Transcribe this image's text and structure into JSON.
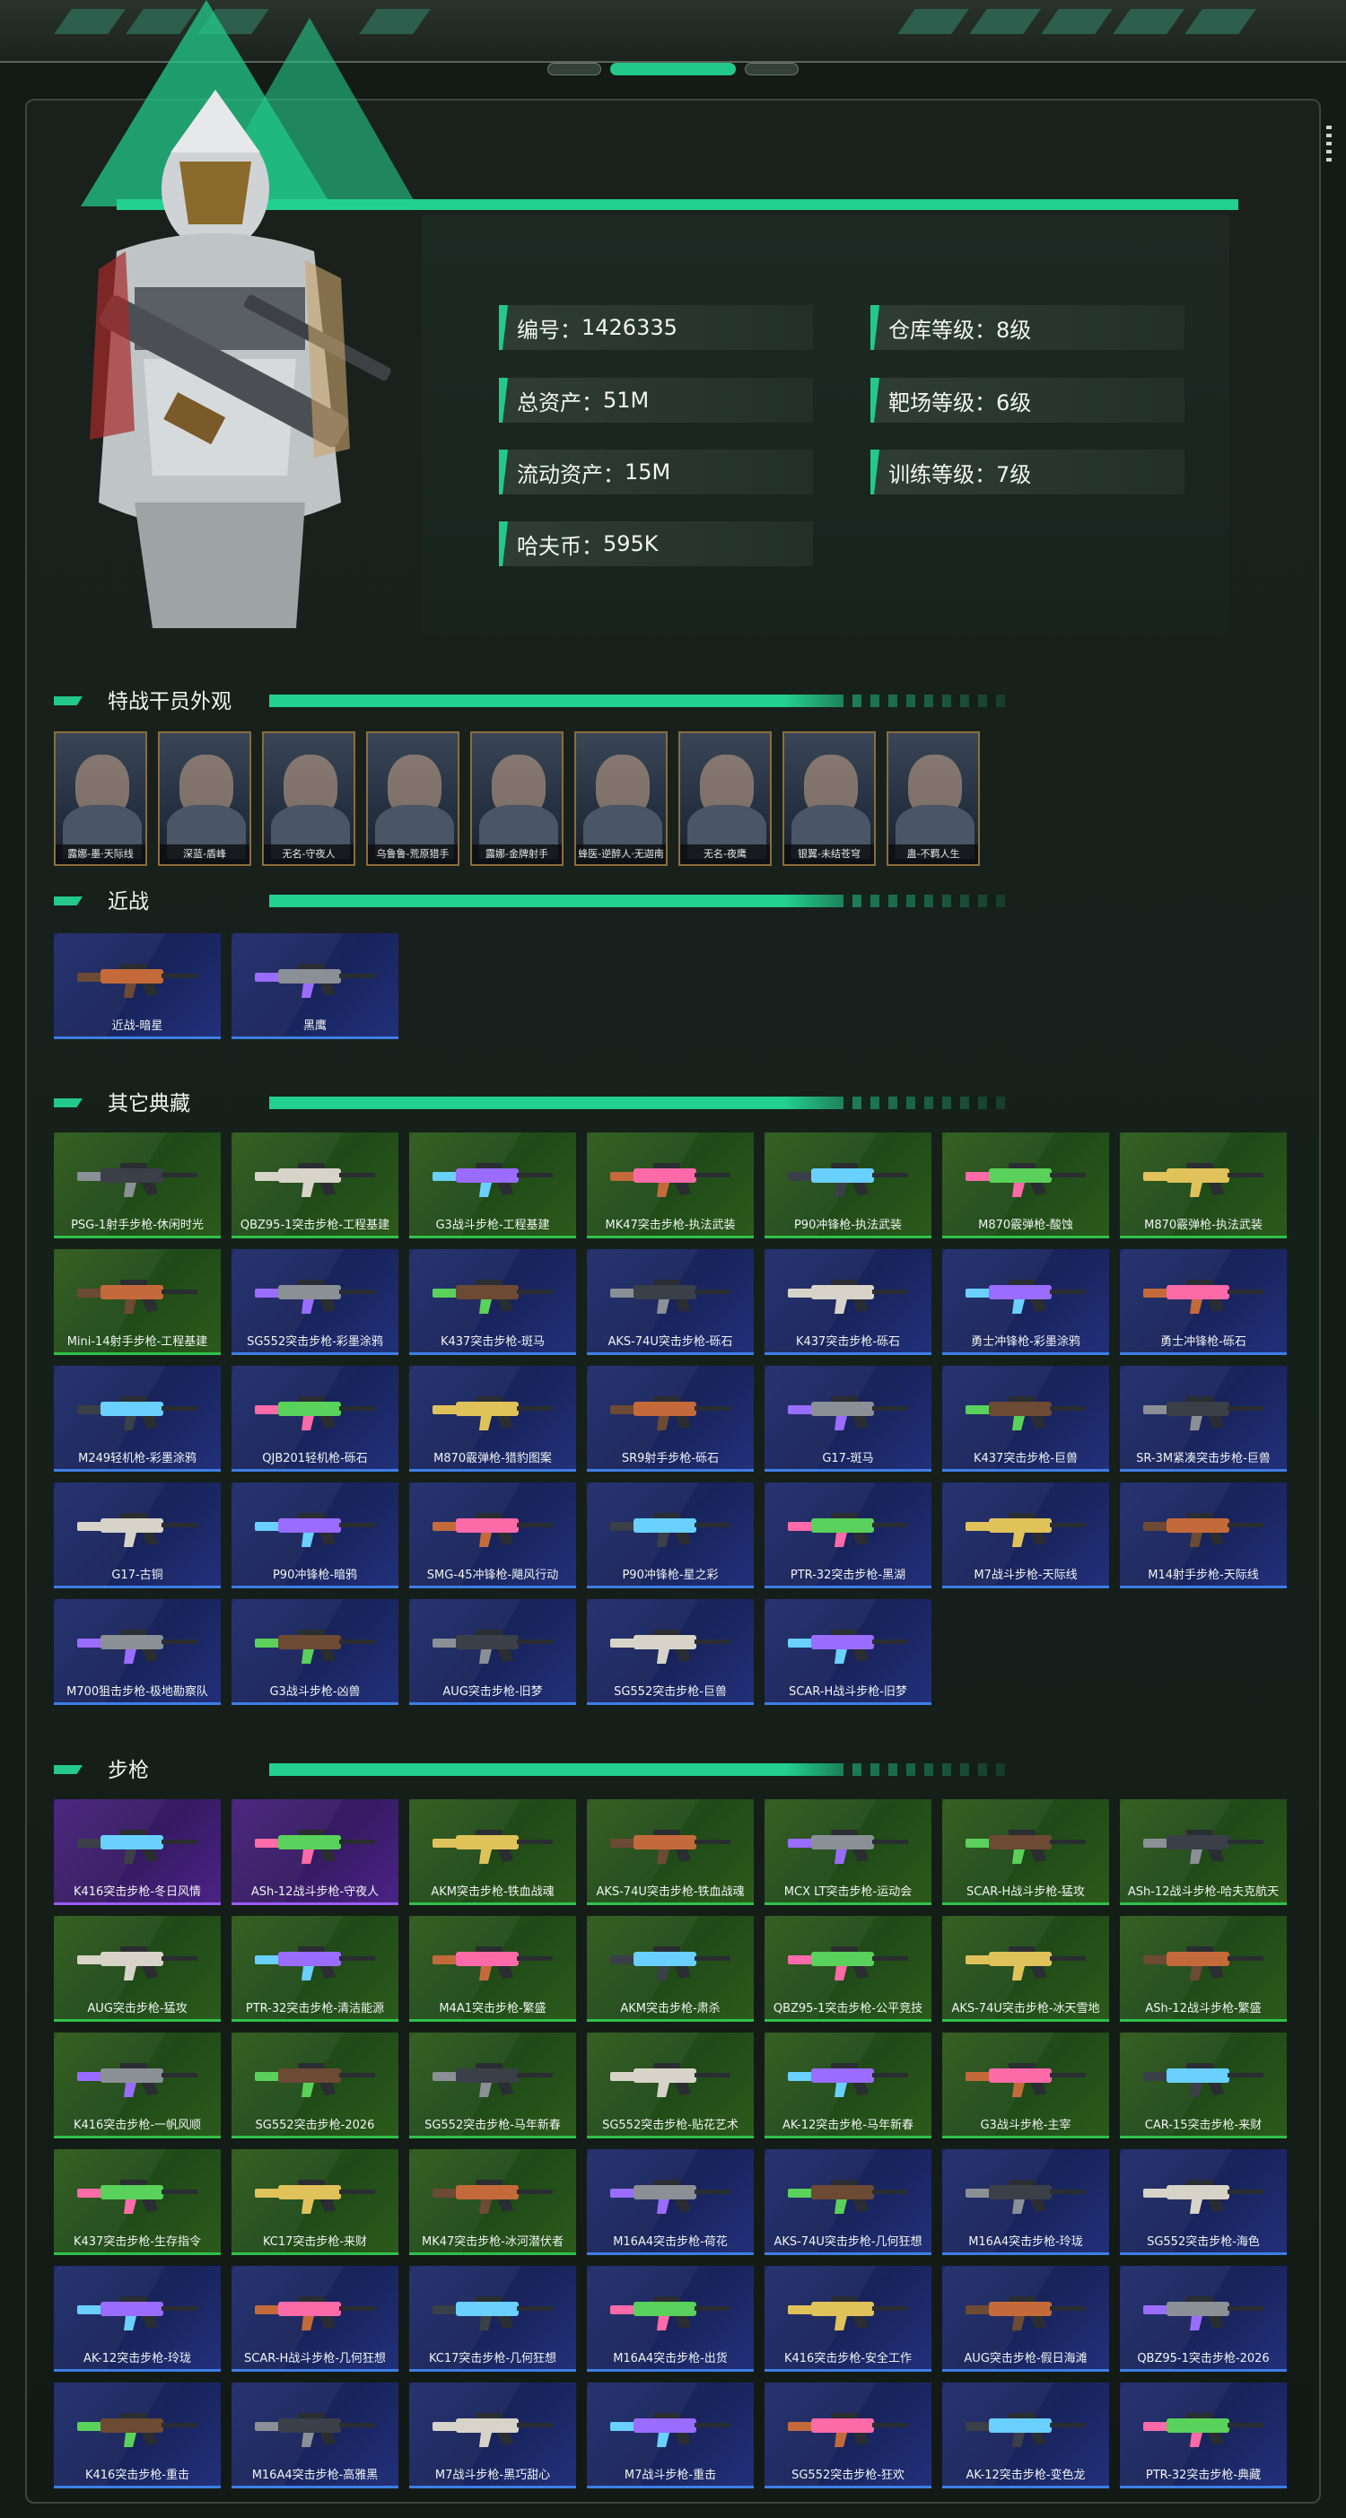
{
  "profile": {
    "stats": [
      {
        "label": "编号",
        "value": "1426335"
      },
      {
        "label": "仓库等级",
        "value": "8级"
      },
      {
        "label": "总资产",
        "value": "51M"
      },
      {
        "label": "靶场等级",
        "value": "6级"
      },
      {
        "label": "流动资产",
        "value": "15M"
      },
      {
        "label": "训练等级",
        "value": "7级"
      },
      {
        "label": "哈夫币",
        "value": "595K"
      }
    ],
    "colon": "："
  },
  "sections": {
    "operators": "特战干员外观",
    "melee": "近战",
    "collection": "其它典藏",
    "rifles": "步枪"
  },
  "operators": [
    "露娜-墨·天际线",
    "深蓝-盾峰",
    "无名-守夜人",
    "乌鲁鲁-荒原猎手",
    "露娜-金牌射手",
    "蜂医-逆醉人·无迦南",
    "无名-夜鹰",
    "银翼-未结苍穹",
    "蛊-不羁人生"
  ],
  "melee": [
    {
      "name": "近战-暗星",
      "color": "blue"
    },
    {
      "name": "黑鹰",
      "color": "blue"
    }
  ],
  "collection": [
    {
      "name": "PSG-1射手步枪-休闲时光",
      "color": "green"
    },
    {
      "name": "QBZ95-1突击步枪-工程基建",
      "color": "green"
    },
    {
      "name": "G3战斗步枪-工程基建",
      "color": "green"
    },
    {
      "name": "MK47突击步枪-执法武装",
      "color": "green"
    },
    {
      "name": "P90冲锋枪-执法武装",
      "color": "green"
    },
    {
      "name": "M870霰弹枪-酸蚀",
      "color": "green"
    },
    {
      "name": "M870霰弹枪-执法武装",
      "color": "green"
    },
    {
      "name": "Mini-14射手步枪-工程基建",
      "color": "green"
    },
    {
      "name": "SG552突击步枪-彩墨涂鸦",
      "color": "blue"
    },
    {
      "name": "K437突击步枪-斑马",
      "color": "blue"
    },
    {
      "name": "AKS-74U突击步枪-砾石",
      "color": "blue"
    },
    {
      "name": "K437突击步枪-砾石",
      "color": "blue"
    },
    {
      "name": "勇士冲锋枪-彩墨涂鸦",
      "color": "blue"
    },
    {
      "name": "勇士冲锋枪-砾石",
      "color": "blue"
    },
    {
      "name": "M249轻机枪-彩墨涂鸦",
      "color": "blue"
    },
    {
      "name": "QJB201轻机枪-砾石",
      "color": "blue"
    },
    {
      "name": "M870霰弹枪-猎豹图案",
      "color": "blue"
    },
    {
      "name": "SR9射手步枪-砾石",
      "color": "blue"
    },
    {
      "name": "G17-斑马",
      "color": "blue"
    },
    {
      "name": "K437突击步枪-巨兽",
      "color": "blue"
    },
    {
      "name": "SR-3M紧凑突击步枪-巨兽",
      "color": "blue"
    },
    {
      "name": "G17-古铜",
      "color": "blue"
    },
    {
      "name": "P90冲锋枪-暗鸦",
      "color": "blue"
    },
    {
      "name": "SMG-45冲锋枪-飓风行动",
      "color": "blue"
    },
    {
      "name": "P90冲锋枪-星之彩",
      "color": "blue"
    },
    {
      "name": "PTR-32突击步枪-黑湖",
      "color": "blue"
    },
    {
      "name": "M7战斗步枪-天际线",
      "color": "blue"
    },
    {
      "name": "M14射手步枪-天际线",
      "color": "blue"
    },
    {
      "name": "M700狙击步枪-极地勘察队",
      "color": "blue"
    },
    {
      "name": "G3战斗步枪-凶兽",
      "color": "blue"
    },
    {
      "name": "AUG突击步枪-旧梦",
      "color": "blue"
    },
    {
      "name": "SG552突击步枪-巨兽",
      "color": "blue"
    },
    {
      "name": "SCAR-H战斗步枪-旧梦",
      "color": "blue"
    }
  ],
  "rifles": [
    {
      "name": "K416突击步枪-冬日风情",
      "color": "purple"
    },
    {
      "name": "ASh-12战斗步枪-守夜人",
      "color": "purple"
    },
    {
      "name": "AKM突击步枪-铁血战魂",
      "color": "green"
    },
    {
      "name": "AKS-74U突击步枪-铁血战魂",
      "color": "green"
    },
    {
      "name": "MCX LT突击步枪-运动会",
      "color": "green"
    },
    {
      "name": "SCAR-H战斗步枪-猛攻",
      "color": "green"
    },
    {
      "name": "ASh-12战斗步枪-哈夫克航天",
      "color": "green"
    },
    {
      "name": "AUG突击步枪-猛攻",
      "color": "green"
    },
    {
      "name": "PTR-32突击步枪-清洁能源",
      "color": "green"
    },
    {
      "name": "M4A1突击步枪-繁盛",
      "color": "green"
    },
    {
      "name": "AKM突击步枪-肃杀",
      "color": "green"
    },
    {
      "name": "QBZ95-1突击步枪-公平竞技",
      "color": "green"
    },
    {
      "name": "AKS-74U突击步枪-冰天雪地",
      "color": "green"
    },
    {
      "name": "ASh-12战斗步枪-繁盛",
      "color": "green"
    },
    {
      "name": "K416突击步枪-一帆风顺",
      "color": "green"
    },
    {
      "name": "SG552突击步枪-2026",
      "color": "green"
    },
    {
      "name": "SG552突击步枪-马年新春",
      "color": "green"
    },
    {
      "name": "SG552突击步枪-贴花艺术",
      "color": "green"
    },
    {
      "name": "AK-12突击步枪-马年新春",
      "color": "green"
    },
    {
      "name": "G3战斗步枪-主宰",
      "color": "green"
    },
    {
      "name": "CAR-15突击步枪-来财",
      "color": "green"
    },
    {
      "name": "K437突击步枪-生存指令",
      "color": "green"
    },
    {
      "name": "KC17突击步枪-来财",
      "color": "green"
    },
    {
      "name": "MK47突击步枪-冰河潜伏者",
      "color": "green"
    },
    {
      "name": "M16A4突击步枪-荷花",
      "color": "blue"
    },
    {
      "name": "AKS-74U突击步枪-几何狂想",
      "color": "blue"
    },
    {
      "name": "M16A4突击步枪-玲珑",
      "color": "blue"
    },
    {
      "name": "SG552突击步枪-海色",
      "color": "blue"
    },
    {
      "name": "AK-12突击步枪-玲珑",
      "color": "blue"
    },
    {
      "name": "SCAR-H战斗步枪-几何狂想",
      "color": "blue"
    },
    {
      "name": "KC17突击步枪-几何狂想",
      "color": "blue"
    },
    {
      "name": "M16A4突击步枪-出货",
      "color": "blue"
    },
    {
      "name": "K416突击步枪-安全工作",
      "color": "blue"
    },
    {
      "name": "AUG突击步枪-假日海滩",
      "color": "blue"
    },
    {
      "name": "QBZ95-1突击步枪-2026",
      "color": "blue"
    },
    {
      "name": "K416突击步枪-重击",
      "color": "blue"
    },
    {
      "name": "M16A4突击步枪-高雅黑",
      "color": "blue"
    },
    {
      "name": "M7战斗步枪-黑巧甜心",
      "color": "blue"
    },
    {
      "name": "M7战斗步枪-重击",
      "color": "blue"
    },
    {
      "name": "SG552突击步枪-狂欢",
      "color": "blue"
    },
    {
      "name": "AK-12突击步枪-变色龙",
      "color": "blue"
    },
    {
      "name": "PTR-32突击步枪-典藏",
      "color": "blue"
    }
  ]
}
